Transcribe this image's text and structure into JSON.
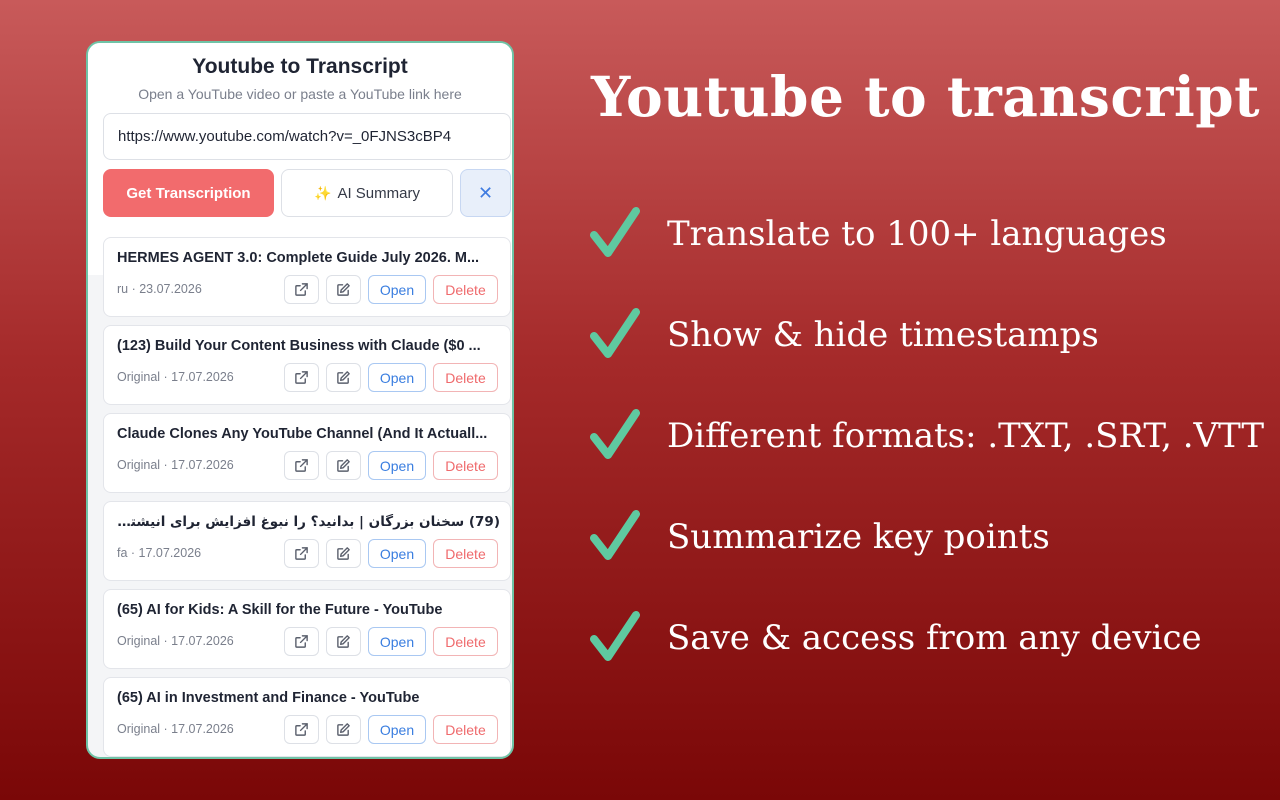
{
  "popup": {
    "title": "Youtube to Transcript",
    "subtitle": "Open a YouTube video or paste a YouTube link here",
    "url_value": "https://www.youtube.com/watch?v=_0FJNS3cBP4",
    "get_button": "Get Transcription",
    "ai_button": "AI Summary",
    "ai_icon": "sparkles-icon",
    "close_icon": "close-icon",
    "items": [
      {
        "title": "HERMES AGENT 3.0: Complete Guide July 2026. M...",
        "meta": "ru · 23.07.2026",
        "open": "Open",
        "delete": "Delete"
      },
      {
        "title": "(123) Build Your Content Business with Claude ($0 ...",
        "meta": "Original · 17.07.2026",
        "open": "Open",
        "delete": "Delete"
      },
      {
        "title": "Claude Clones Any YouTube Channel (And It Actuall...",
        "meta": "Original · 17.07.2026",
        "open": "Open",
        "delete": "Delete"
      },
      {
        "title": "(79) سخنان بزرگان | بدانید؟ را نبوغ افزایش برای انیشتین باب...",
        "meta": "fa · 17.07.2026",
        "open": "Open",
        "delete": "Delete"
      },
      {
        "title": "(65) AI for Kids: A Skill for the Future - YouTube",
        "meta": "Original · 17.07.2026",
        "open": "Open",
        "delete": "Delete"
      },
      {
        "title": "(65) AI in Investment and Finance - YouTube",
        "meta": "Original · 17.07.2026",
        "open": "Open",
        "delete": "Delete"
      }
    ]
  },
  "hero": {
    "title": "Youtube to transcript",
    "features": [
      "Translate to 100+ languages",
      "Show & hide timestamps",
      "Different formats: .TXT, .SRT, .VTT",
      "Summarize key points",
      "Save & access from any device"
    ],
    "check_color": "#5fc9a0"
  },
  "colors": {
    "primary": "#f26b6d",
    "accent_blue": "#3a7ee0",
    "border_green": "#6fc3a6"
  }
}
